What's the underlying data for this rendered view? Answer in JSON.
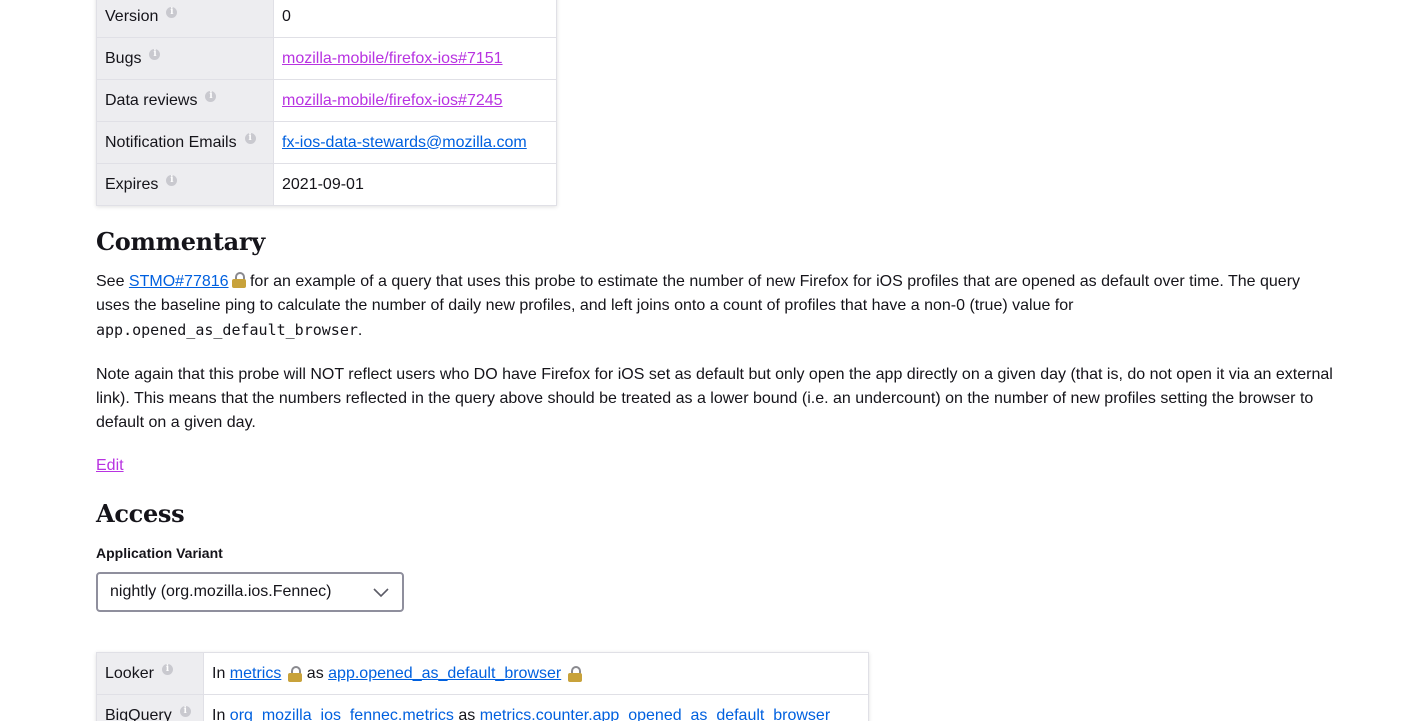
{
  "metadata": {
    "rows": [
      {
        "key": "Version",
        "value": "0",
        "type": "text"
      },
      {
        "key": "Bugs",
        "value": "mozilla-mobile/firefox-ios#7151",
        "type": "link-visited"
      },
      {
        "key": "Data reviews",
        "value": "mozilla-mobile/firefox-ios#7245",
        "type": "link-visited"
      },
      {
        "key": "Notification Emails",
        "value": "fx-ios-data-stewards@mozilla.com",
        "type": "link"
      },
      {
        "key": "Expires",
        "value": "2021-09-01",
        "type": "text"
      }
    ]
  },
  "commentary": {
    "heading": "Commentary",
    "p1_prefix": "See ",
    "p1_link": "STMO#77816",
    "p1_after_link": " for an example of a query that uses this probe to estimate the number of new Firefox for iOS profiles that are opened as default over time. The query uses the baseline ping to calculate the number of daily new profiles, and left joins onto a count of profiles that have a non-0 (true) value for ",
    "p1_code": "app.opened_as_default_browser",
    "p1_end": ".",
    "p2": "Note again that this probe will NOT reflect users who DO have Firefox for iOS set as default but only open the app directly on a given day (that is, do not open it via an external link). This means that the numbers reflected in the query above should be treated as a lower bound (i.e. an undercount) on the number of new profiles setting the browser to default on a given day.",
    "edit_label": "Edit"
  },
  "access": {
    "heading": "Access",
    "variant_label": "Application Variant",
    "variant_selected": "nightly (org.mozilla.ios.Fennec)",
    "rows": {
      "looker": {
        "key": "Looker",
        "prefix": "In ",
        "link1": "metrics",
        "middle": " as ",
        "link2": "app.opened_as_default_browser"
      },
      "bigquery": {
        "key": "BigQuery",
        "prefix": "In ",
        "link1": "org_mozilla_ios_fennec.metrics",
        "middle": " as ",
        "link2": "metrics.counter.app_opened_as_default_browser"
      }
    }
  },
  "colors": {
    "link": "#0060df",
    "visited_link": "#b833e1",
    "key_bg": "#ededf0"
  },
  "icons": {
    "info": "info-icon",
    "lock": "lock-icon",
    "chevron": "chevron-down-icon"
  }
}
